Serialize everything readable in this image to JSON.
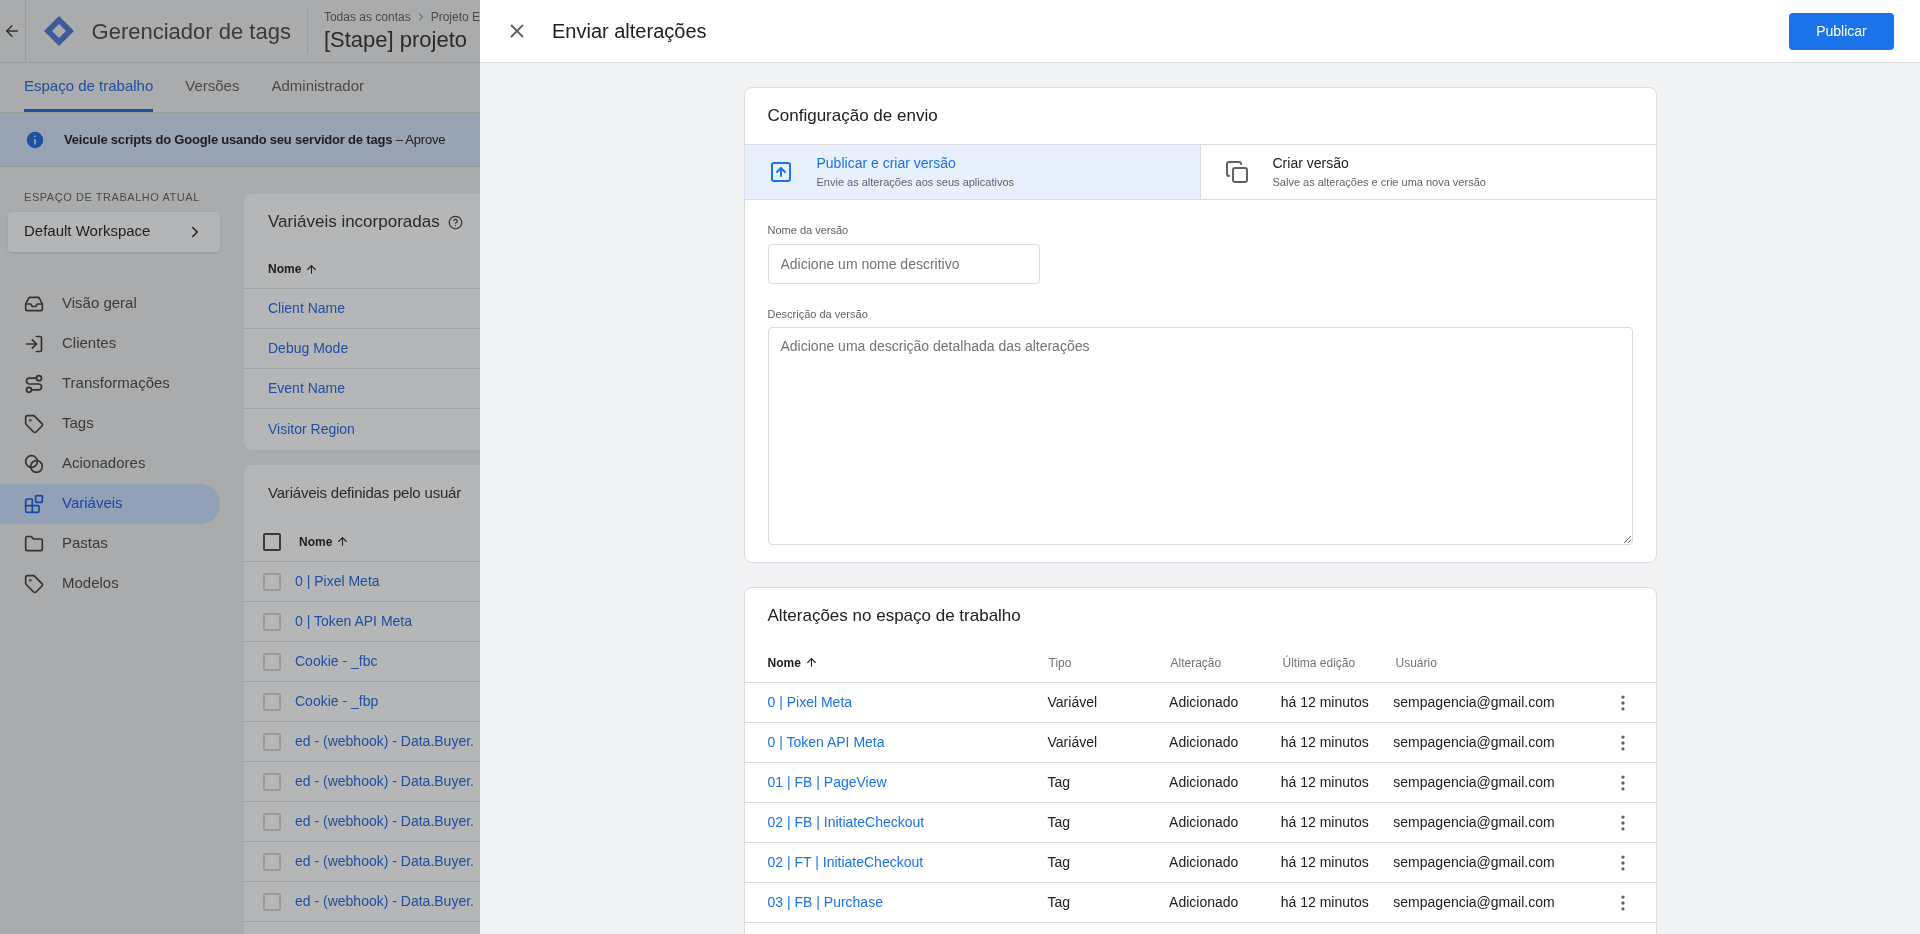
{
  "header": {
    "product": "Gerenciador de tags",
    "breadcrumb": [
      "Todas as contas",
      "Projeto E"
    ],
    "container": "[Stape] projeto"
  },
  "tabs": [
    {
      "label": "Espaço de trabalho",
      "selected": true
    },
    {
      "label": "Versões",
      "selected": false
    },
    {
      "label": "Administrador",
      "selected": false
    }
  ],
  "banner": {
    "text": "**Veicule scripts do Google usando seu servidor de tags** – Aprove"
  },
  "sidebar": {
    "section_label": "ESPAÇO DE TRABALHO ATUAL",
    "workspace": "Default Workspace",
    "items": [
      {
        "label": "Visão geral",
        "selected": false
      },
      {
        "label": "Clientes",
        "selected": false
      },
      {
        "label": "Transformações",
        "selected": false
      },
      {
        "label": "Tags",
        "selected": false
      },
      {
        "label": "Acionadores",
        "selected": false
      },
      {
        "label": "Variáveis",
        "selected": true
      },
      {
        "label": "Pastas",
        "selected": false
      },
      {
        "label": "Modelos",
        "selected": false
      }
    ]
  },
  "builtin_variables": {
    "title": "Variáveis incorporadas",
    "column": "Nome",
    "rows": [
      "Client Name",
      "Debug Mode",
      "Event Name",
      "Visitor Region"
    ]
  },
  "user_variables": {
    "title": "Variáveis definidas pelo usuár",
    "column": "Nome",
    "header_checked": false,
    "rows": [
      {
        "name": "0 | Pixel Meta",
        "checked": false
      },
      {
        "name": "0 | Token API Meta",
        "checked": false
      },
      {
        "name": "Cookie - _fbc",
        "checked": false
      },
      {
        "name": "Cookie - _fbp",
        "checked": false
      },
      {
        "name": "ed - (webhook) - Data.Buyer.",
        "checked": false
      },
      {
        "name": "ed - (webhook) - Data.Buyer.",
        "checked": false
      },
      {
        "name": "ed - (webhook) - Data.Buyer.",
        "checked": false
      },
      {
        "name": "ed - (webhook) - Data.Buyer.",
        "checked": false
      },
      {
        "name": "ed - (webhook) - Data.Buyer.",
        "checked": false
      }
    ]
  },
  "dialog": {
    "title": "Enviar alterações",
    "publish_button": "Publicar",
    "submission": {
      "title": "Configuração de envio",
      "options": [
        {
          "title": "Publicar e criar versão",
          "subtitle": "Envie as alterações aos seus aplicativos",
          "selected": true
        },
        {
          "title": "Criar versão",
          "subtitle": "Salve as alterações e crie uma nova versão",
          "selected": false
        }
      ],
      "version_name": {
        "label": "Nome da versão",
        "placeholder": "Adicione um nome descritivo"
      },
      "version_description": {
        "label": "Descrição da versão",
        "placeholder": "Adicione uma descrição detalhada das alterações"
      }
    },
    "changes": {
      "title": "Alterações no espaço de trabalho",
      "columns": [
        "Nome",
        "Tipo",
        "Alteração",
        "Última edição",
        "Usuário"
      ],
      "rows": [
        {
          "name": "0 | Pixel Meta",
          "type": "Variável",
          "change": "Adicionado",
          "edited": "há 12 minutos",
          "user": "sempagencia@gmail.com"
        },
        {
          "name": "0 | Token API Meta",
          "type": "Variável",
          "change": "Adicionado",
          "edited": "há 12 minutos",
          "user": "sempagencia@gmail.com"
        },
        {
          "name": "01 | FB | PageView",
          "type": "Tag",
          "change": "Adicionado",
          "edited": "há 12 minutos",
          "user": "sempagencia@gmail.com"
        },
        {
          "name": "02 | FB | InitiateCheckout",
          "type": "Tag",
          "change": "Adicionado",
          "edited": "há 12 minutos",
          "user": "sempagencia@gmail.com"
        },
        {
          "name": "02 | FT | InitiateCheckout",
          "type": "Tag",
          "change": "Adicionado",
          "edited": "há 12 minutos",
          "user": "sempagencia@gmail.com"
        },
        {
          "name": "03 | FB | Purchase",
          "type": "Tag",
          "change": "Adicionado",
          "edited": "há 12 minutos",
          "user": "sempagencia@gmail.com"
        }
      ]
    }
  }
}
